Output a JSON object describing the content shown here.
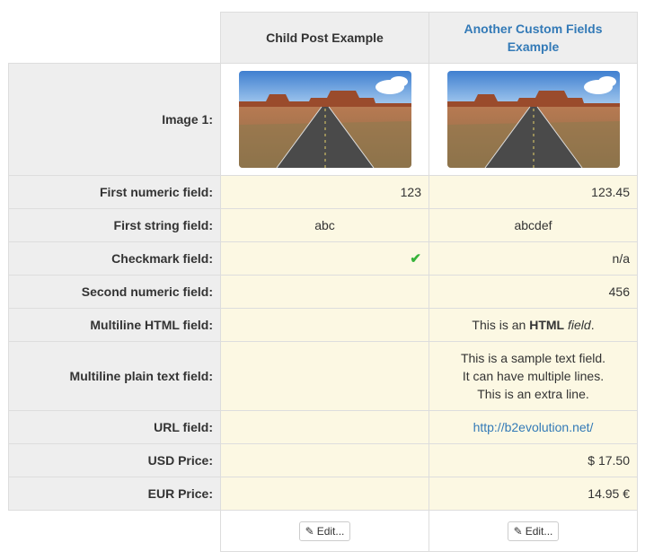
{
  "columns": [
    {
      "title": "Child Post Example",
      "is_link": false
    },
    {
      "title": "Another Custom Fields Example",
      "is_link": true
    }
  ],
  "rows": {
    "image_label": "Image 1:",
    "first_numeric": {
      "label": "First numeric field:",
      "values": [
        "123",
        "123.45"
      ]
    },
    "first_string": {
      "label": "First string field:",
      "values": [
        "abc",
        "abcdef"
      ]
    },
    "checkmark": {
      "label": "Checkmark field:",
      "values": [
        "check-icon",
        "n/a"
      ]
    },
    "second_numeric": {
      "label": "Second numeric field:",
      "values": [
        "",
        "456"
      ]
    },
    "multiline_html": {
      "label": "Multiline HTML field:",
      "values": [
        "",
        "This is an HTML field."
      ],
      "prefix": "This is an ",
      "bold": "HTML",
      "italic": "field",
      "suffix": "."
    },
    "multiline_plain": {
      "label": "Multiline plain text field:",
      "lines": [
        "This is a sample text field.",
        "It can have multiple lines.",
        "This is an extra line."
      ]
    },
    "url": {
      "label": "URL field:",
      "values": [
        "",
        "http://b2evolution.net/"
      ]
    },
    "usd": {
      "label": "USD Price:",
      "values": [
        "",
        "$ 17.50"
      ]
    },
    "eur": {
      "label": "EUR Price:",
      "values": [
        "",
        "14.95 €"
      ]
    }
  },
  "actions": {
    "edit_label": "Edit...",
    "edit_icon": "edit-icon"
  },
  "colors": {
    "label_bg": "#eeeeee",
    "value_bg": "#fcf8e3",
    "link": "#337ab7",
    "check": "#36b33a"
  }
}
